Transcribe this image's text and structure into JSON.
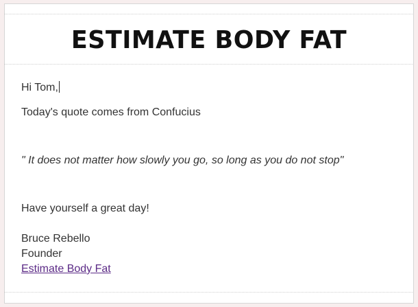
{
  "header": {
    "title": "ESTIMATE BODY FAT"
  },
  "email": {
    "greeting": "Hi Tom,",
    "intro": "Today's quote comes from Confucius",
    "quote": "\" It does not matter how slowly you go, so long as you do not stop\"",
    "closing": "Have yourself a great day!",
    "signature": {
      "name": "Bruce Rebello",
      "role": "Founder",
      "link_text": "Estimate Body Fat"
    }
  }
}
